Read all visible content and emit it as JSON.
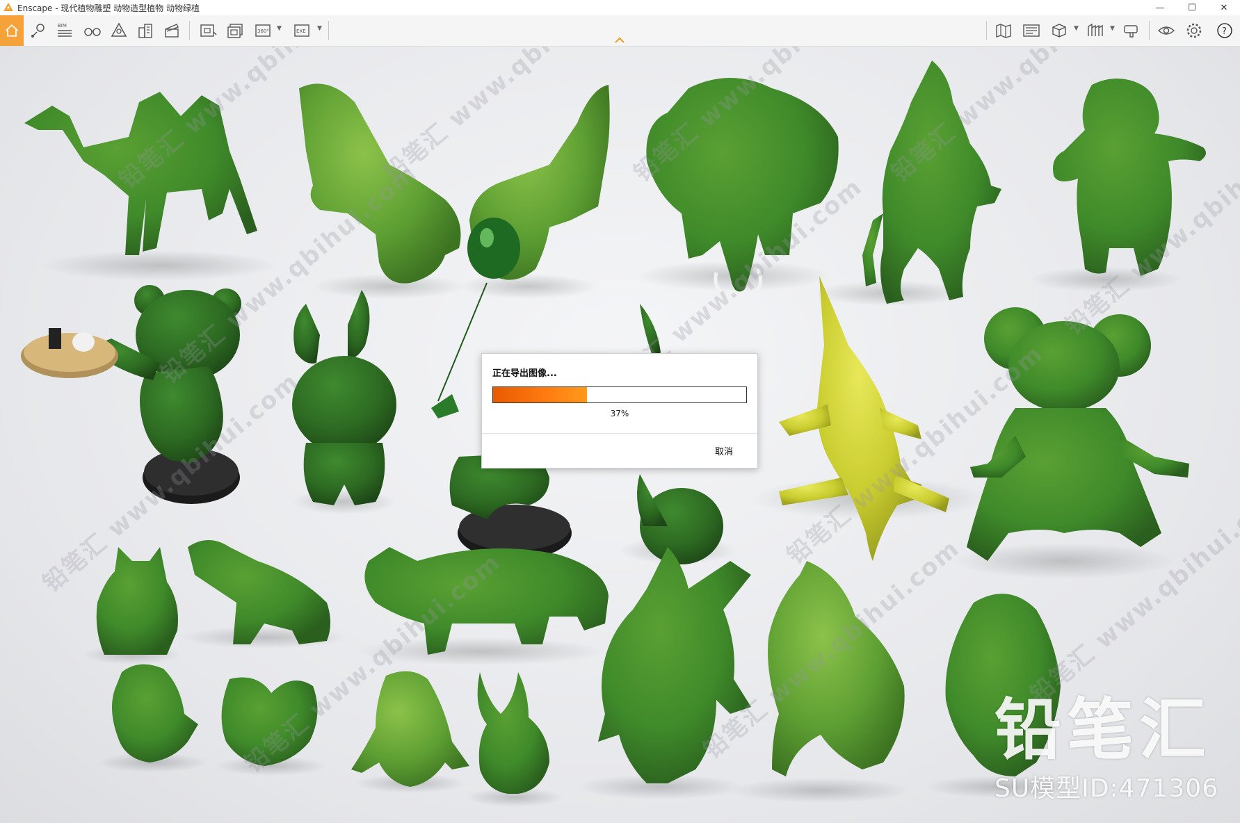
{
  "window": {
    "title": "Enscape - 现代植物雕塑 动物造型植物 动物绿植",
    "minimize": "—",
    "maximize": "☐",
    "close": "✕"
  },
  "toolbar": {
    "left_icons": [
      "home-icon",
      "location-pin-icon",
      "bim-icon",
      "binoculars-icon",
      "asset-library-icon",
      "buildings-icon",
      "video-editor-icon",
      "screenshot-icon",
      "batch-render-icon",
      "panorama-360-icon",
      "export-exe-icon"
    ],
    "bim_label": "BIM",
    "pano_label": "360°",
    "exe_label": "EXE",
    "right_icons": [
      "map-icon",
      "panel-icon",
      "view-cube-icon",
      "sections-icon",
      "material-editor-icon",
      "visual-settings-icon",
      "settings-gear-icon",
      "help-icon"
    ],
    "help_label": "?"
  },
  "dialog": {
    "title": "正在导出图像...",
    "progress": 0.37,
    "progress_text": "37%",
    "cancel_label": "取消"
  },
  "watermark": {
    "small_text": "铅笔汇 www.qbihui.com",
    "brand_name": "铅笔汇",
    "model_id": "SU模型ID:471306"
  },
  "colors": {
    "accent": "#f5a23a",
    "progress": "#ff7a10",
    "topiary_dark": "#2f6d22",
    "topiary_mid": "#3f8a2a",
    "topiary_light": "#6ba838",
    "crocodile": "#c9cc2e"
  }
}
